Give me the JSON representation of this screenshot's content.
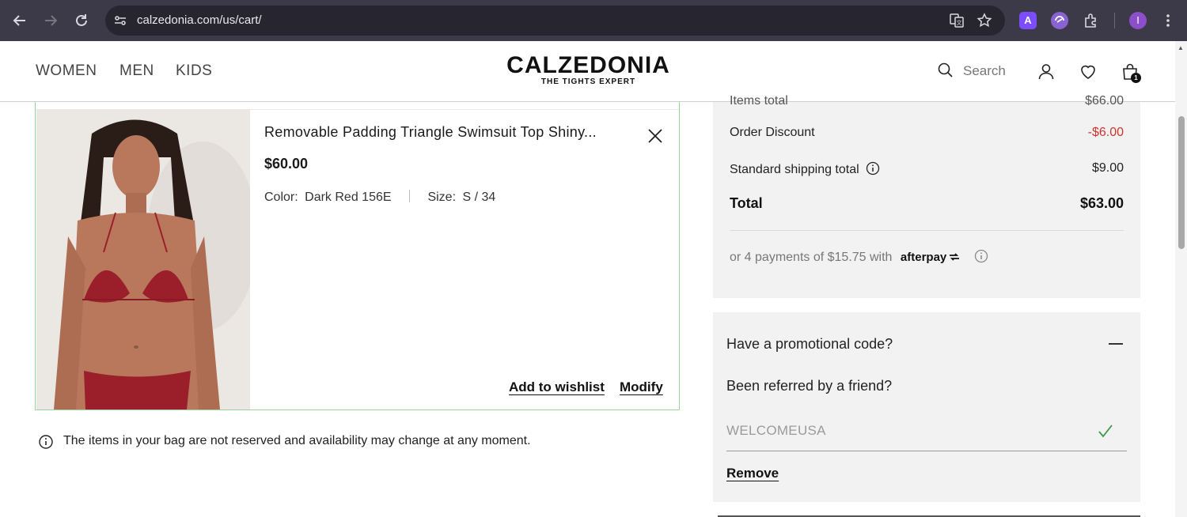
{
  "browser": {
    "url": "calzedonia.com/us/cart/",
    "back_icon": "arrow-left",
    "forward_icon": "arrow-right",
    "reload_icon": "reload",
    "extension_a_label": "A"
  },
  "header": {
    "nav": [
      "WOMEN",
      "MEN",
      "KIDS"
    ],
    "logo": {
      "brand": "CALZEDONIA",
      "tagline": "THE TIGHTS EXPERT"
    },
    "search_label": "Search",
    "bag_count": "1"
  },
  "cart_item": {
    "name": "Removable Padding Triangle Swimsuit Top Shiny...",
    "price": "$60.00",
    "color_label": "Color:",
    "color_value": "Dark Red 156E",
    "size_label": "Size:",
    "size_value": "S / 34",
    "wishlist_label": "Add to wishlist",
    "modify_label": "Modify",
    "image_colors": {
      "swimsuit": "#9b1f2a",
      "skin": "#b9785c",
      "hair": "#2a1c17"
    }
  },
  "notice": "The items in your bag are not reserved and availability may change at any moment.",
  "summary": {
    "cut_label": "Items total",
    "cut_value": "$66.00",
    "discount_label": "Order Discount",
    "discount_value": "-$6.00",
    "shipping_label": "Standard shipping total",
    "shipping_value": "$9.00",
    "total_label": "Total",
    "total_value": "$63.00",
    "afterpay_text": "or 4 payments of $15.75 with",
    "afterpay_brand": "afterpay"
  },
  "promo": {
    "heading": "Have a promotional code?",
    "referral_heading": "Been referred by a friend?",
    "code_value": "WELCOMEUSA",
    "remove_label": "Remove"
  },
  "colors": {
    "accent_green": "#9ed39e",
    "discount_red": "#d0342c",
    "panel_bg": "#f2f2f2"
  }
}
